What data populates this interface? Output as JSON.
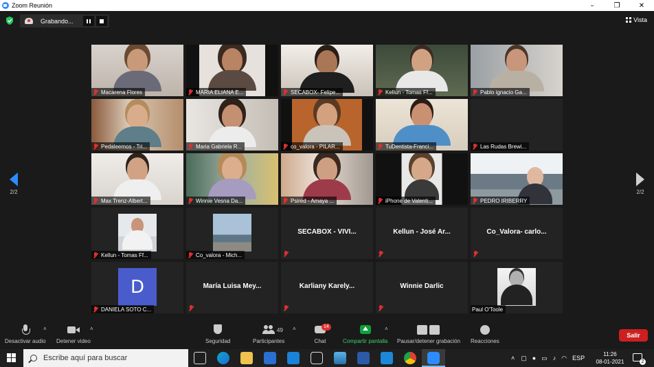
{
  "window": {
    "title": "Zoom Reunión"
  },
  "recording": {
    "label": "Grabando..."
  },
  "view": {
    "label": "Vista"
  },
  "pagination": {
    "left": "2/2",
    "right": "2/2"
  },
  "participants": [
    {
      "name": "Macarena Flores",
      "kind": "video"
    },
    {
      "name": "MARIA ELIANA E...",
      "kind": "video"
    },
    {
      "name": "SECABOX- Felipe...",
      "kind": "video"
    },
    {
      "name": "Kellun - Tomas Ff...",
      "kind": "video"
    },
    {
      "name": "Pablo ignacio Ga...",
      "kind": "video"
    },
    {
      "name": "Pedaleemos - Tri...",
      "kind": "video"
    },
    {
      "name": "Maria Gabriela R...",
      "kind": "video"
    },
    {
      "name": "co_valora - PILAR...",
      "kind": "video"
    },
    {
      "name": "TuDentista-Franci...",
      "kind": "video"
    },
    {
      "name": "Las Rudas Brewi...",
      "kind": "off"
    },
    {
      "name": "Max Trenz-Albert...",
      "kind": "video"
    },
    {
      "name": "Winnie Vesna Da...",
      "kind": "video"
    },
    {
      "name": "Psired - Amaya ...",
      "kind": "video"
    },
    {
      "name": "iPhone de Valenti...",
      "kind": "video"
    },
    {
      "name": "PEDRO IRIBERRY",
      "kind": "video"
    },
    {
      "name": "Kellun - Tomas Ff...",
      "kind": "photo"
    },
    {
      "name": "Co_valora - Mich...",
      "kind": "photo"
    },
    {
      "name": "SECABOX - VIVI...",
      "kind": "name"
    },
    {
      "name": "Kellun - José Ar...",
      "kind": "name"
    },
    {
      "name": "Co_Valora-  carlo...",
      "kind": "name"
    },
    {
      "name": "DANIELA SOTO C...",
      "kind": "avatar",
      "initial": "D"
    },
    {
      "name": "María Luisa Mey...",
      "kind": "name"
    },
    {
      "name": "Karliany  Karely...",
      "kind": "name"
    },
    {
      "name": "Winnie Darlic",
      "kind": "name"
    },
    {
      "name": "Paul O'Toole",
      "kind": "photo-unmuted"
    }
  ],
  "toolbar": {
    "mute": "Desactivar audio",
    "video": "Detener video",
    "security": "Seguridad",
    "participants": "Participantes",
    "participants_count": "49",
    "chat": "Chat",
    "chat_badge": "14",
    "share": "Compartir pantalla",
    "record": "Pausar/detener grabación",
    "reactions": "Reacciones",
    "leave": "Salir"
  },
  "taskbar": {
    "search_placeholder": "Escribe aquí para buscar",
    "language": "ESP",
    "time": "11:26",
    "date": "08-01-2021",
    "notifications": "2"
  },
  "colors": {
    "accent": "#2d8cff",
    "muted": "#e02f2f",
    "share": "#0e9f3b",
    "leave": "#cc1f1f"
  }
}
